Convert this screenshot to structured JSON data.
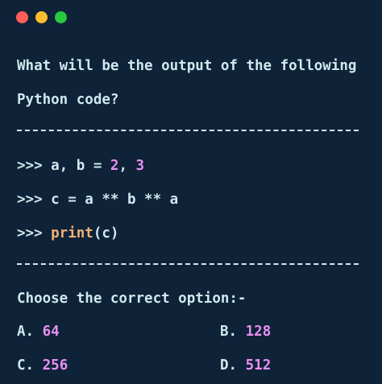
{
  "window": {
    "controls": [
      {
        "name": "close",
        "color": "#ff5f57"
      },
      {
        "name": "minimize",
        "color": "#febc2e"
      },
      {
        "name": "maximize",
        "color": "#28c840"
      }
    ]
  },
  "question": {
    "line1": "What will be the output of the following",
    "line2": "Python code?"
  },
  "code": {
    "line1": {
      "prompt": ">>>",
      "text_a": " a, b = ",
      "num1": "2",
      "sep": ", ",
      "num2": "3"
    },
    "line2": {
      "prompt": ">>>",
      "text": " c = a ** b ** a"
    },
    "line3": {
      "prompt": ">>>",
      "fn": " print",
      "paren_open": "(",
      "arg": "c",
      "paren_close": ")"
    }
  },
  "prompt_text": "Choose the correct option:-",
  "options": [
    {
      "letter": "A.",
      "value": "64"
    },
    {
      "letter": "B.",
      "value": "128"
    },
    {
      "letter": "C.",
      "value": "256"
    },
    {
      "letter": "D.",
      "value": "512"
    }
  ],
  "colors": {
    "background": "#0e2238",
    "text": "#cfe9ee",
    "number": "#e98ff0",
    "function": "#f0b07a"
  }
}
